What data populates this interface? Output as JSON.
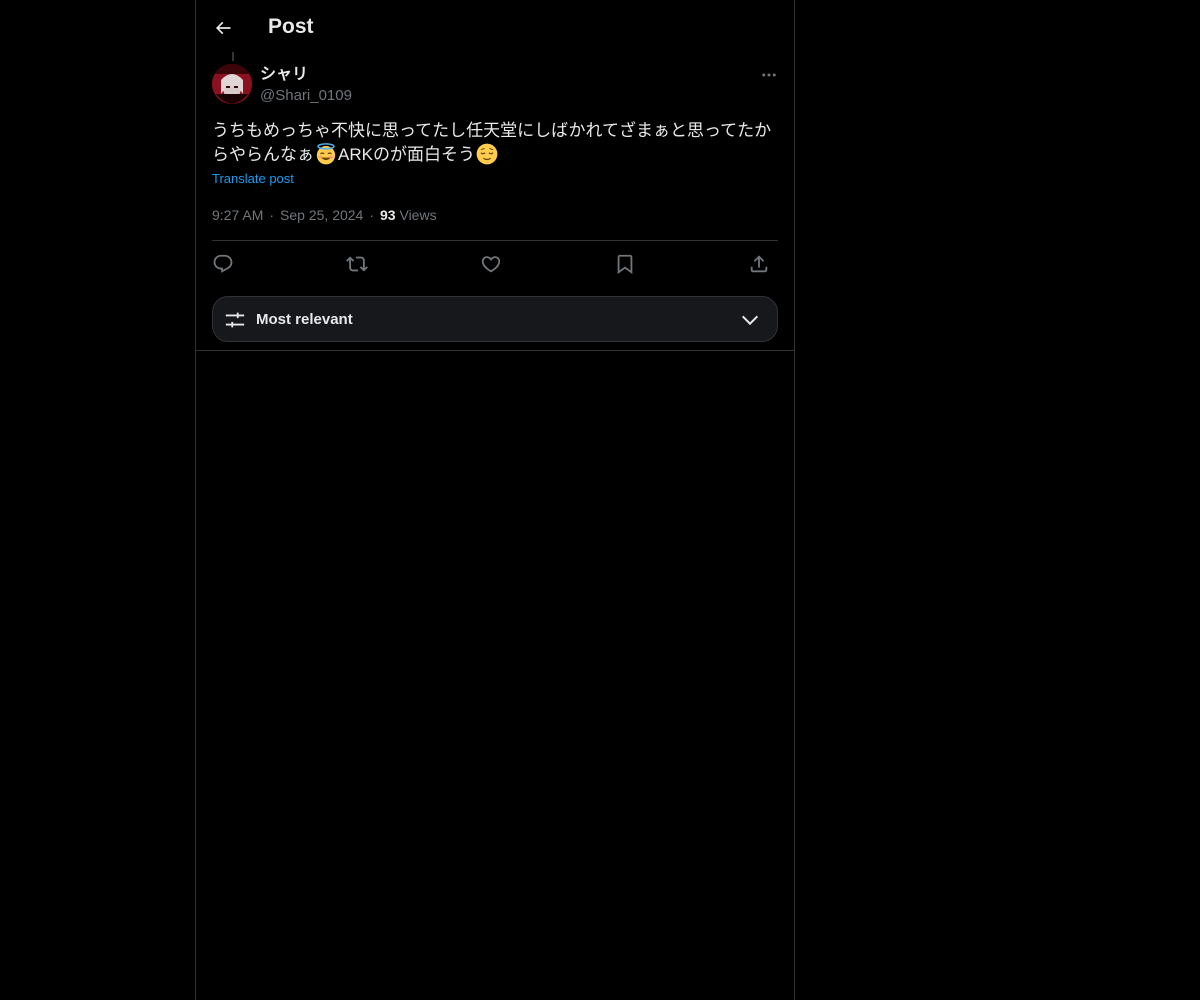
{
  "header": {
    "title": "Post",
    "back_icon": "arrow-left-icon"
  },
  "author": {
    "display_name": "シャリ",
    "handle": "@Shari_0109",
    "avatar_color": "#5a0a12"
  },
  "post": {
    "text_part1": "うちもめっちゃ不快に思ってたし任天堂にしばかれてざまぁと思ってたからやらんなぁ",
    "emoji1": "smiling-face-with-halo",
    "text_part2": "ARKのが面白そう",
    "emoji2": "relieved-face",
    "translate_label": "Translate post",
    "time": "9:27 AM",
    "date": "Sep 25, 2024",
    "view_count": "93",
    "views_label": "Views"
  },
  "actions": {
    "items": [
      "reply-icon",
      "repost-icon",
      "like-icon",
      "bookmark-icon",
      "share-icon"
    ]
  },
  "replies_sort": {
    "label": "Most relevant",
    "icon": "sliders-icon",
    "chevron": "chevron-down-icon"
  },
  "colors": {
    "background": "#000000",
    "text_primary": "#e7e9ea",
    "text_secondary": "#71767b",
    "accent": "#1d9bf0",
    "border": "#2f3336"
  }
}
